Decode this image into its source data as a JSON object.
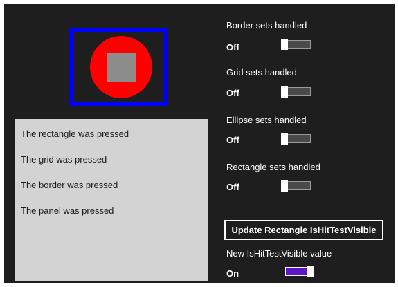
{
  "log": {
    "items": [
      "The rectangle was pressed",
      "The grid was pressed",
      "The border was pressed",
      "The panel was pressed"
    ]
  },
  "settings": [
    {
      "label": "Border sets handled",
      "state": "Off"
    },
    {
      "label": "Grid sets handled",
      "state": "Off"
    },
    {
      "label": "Ellipse sets handled",
      "state": "Off"
    },
    {
      "label": "Rectangle sets handled",
      "state": "Off"
    }
  ],
  "update_button": "Update Rectangle IsHitTestVisible",
  "new_value": {
    "label": "New IsHitTestVisible value",
    "state": "On"
  },
  "colors": {
    "background": "#1e1e1e",
    "border": "#0000ff",
    "ellipse": "#ff0000",
    "rectangle": "#8c8c8c",
    "panel": "#d3d3d3",
    "toggle_on": "#5b17c6"
  }
}
